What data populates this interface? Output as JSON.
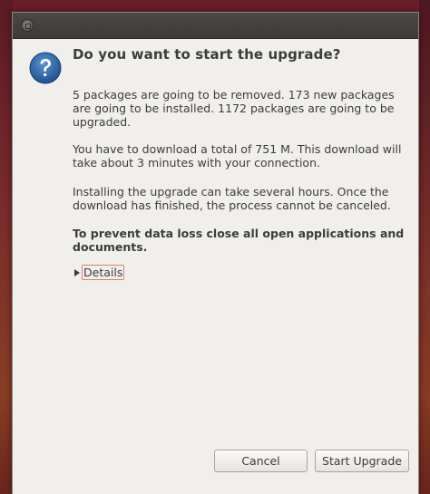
{
  "dialog": {
    "heading": "Do you want to start the upgrade?",
    "paragraphs": [
      "5 packages are going to be removed. 173 new packages are going to be installed. 1172 packages are going to be upgraded.",
      "You have to download a total of 751 M. This download will take about 3 minutes with your connection.",
      "Installing the upgrade can take several hours. Once the download has finished, the process cannot be canceled."
    ],
    "warning": "To prevent data loss close all open applications and documents.",
    "details_label": "Details",
    "icon": "question-icon"
  },
  "buttons": {
    "cancel_label": "Cancel",
    "start_label": "Start Upgrade"
  },
  "colors": {
    "dialog_bg": "#f1efec",
    "titlebar": "#3c3b37",
    "icon_blue": "#2a64a6",
    "focus_outline": "#e08060",
    "text": "#3c3c3c"
  }
}
